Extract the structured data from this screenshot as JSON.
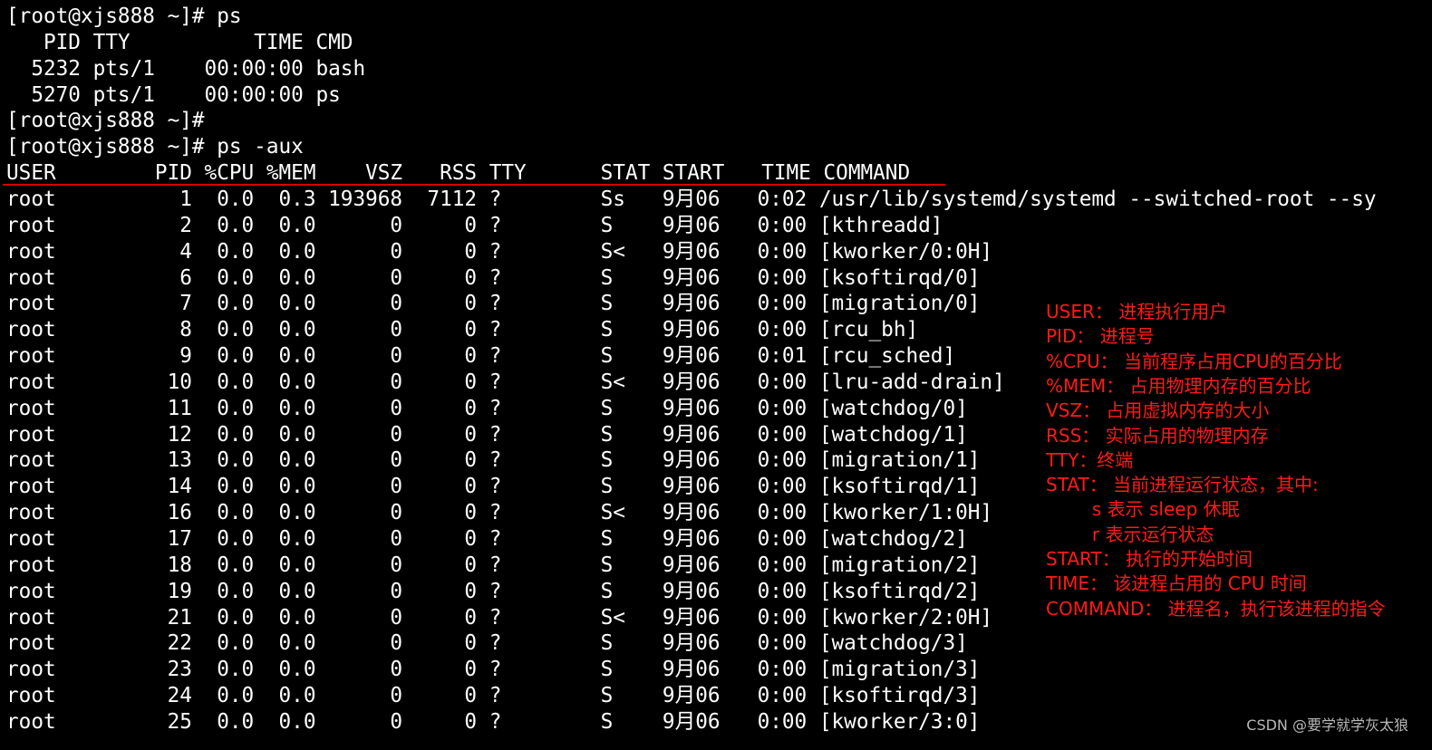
{
  "terminal": {
    "lines": [
      "[root@xjs888 ~]# ps",
      "   PID TTY          TIME CMD",
      "  5232 pts/1    00:00:00 bash",
      "  5270 pts/1    00:00:00 ps",
      "[root@xjs888 ~]#",
      "[root@xjs888 ~]# ps -aux",
      "USER        PID %CPU %MEM    VSZ   RSS TTY      STAT START   TIME COMMAND",
      "root          1  0.0  0.3 193968  7112 ?        Ss   9月06   0:02 /usr/lib/systemd/systemd --switched-root --sy",
      "root          2  0.0  0.0      0     0 ?        S    9月06   0:00 [kthreadd]",
      "root          4  0.0  0.0      0     0 ?        S<   9月06   0:00 [kworker/0:0H]",
      "root          6  0.0  0.0      0     0 ?        S    9月06   0:00 [ksoftirqd/0]",
      "root          7  0.0  0.0      0     0 ?        S    9月06   0:00 [migration/0]",
      "root          8  0.0  0.0      0     0 ?        S    9月06   0:00 [rcu_bh]",
      "root          9  0.0  0.0      0     0 ?        S    9月06   0:01 [rcu_sched]",
      "root         10  0.0  0.0      0     0 ?        S<   9月06   0:00 [lru-add-drain]",
      "root         11  0.0  0.0      0     0 ?        S    9月06   0:00 [watchdog/0]",
      "root         12  0.0  0.0      0     0 ?        S    9月06   0:00 [watchdog/1]",
      "root         13  0.0  0.0      0     0 ?        S    9月06   0:00 [migration/1]",
      "root         14  0.0  0.0      0     0 ?        S    9月06   0:00 [ksoftirqd/1]",
      "root         16  0.0  0.0      0     0 ?        S<   9月06   0:00 [kworker/1:0H]",
      "root         17  0.0  0.0      0     0 ?        S    9月06   0:00 [watchdog/2]",
      "root         18  0.0  0.0      0     0 ?        S    9月06   0:00 [migration/2]",
      "root         19  0.0  0.0      0     0 ?        S    9月06   0:00 [ksoftirqd/2]",
      "root         21  0.0  0.0      0     0 ?        S<   9月06   0:00 [kworker/2:0H]",
      "root         22  0.0  0.0      0     0 ?        S    9月06   0:00 [watchdog/3]",
      "root         23  0.0  0.0      0     0 ?        S    9月06   0:00 [migration/3]",
      "root         24  0.0  0.0      0     0 ?        S    9月06   0:00 [ksoftirqd/3]",
      "root         25  0.0  0.0      0     0 ?        S    9月06   0:00 [kworker/3:0]"
    ],
    "background_color": "#000000",
    "text_color": "#ffffff"
  },
  "annotations": {
    "color": "#ff1a1a",
    "items": [
      "USER： 进程执行用户",
      "PID： 进程号",
      "%CPU： 当前程序占用CPU的百分比",
      "%MEM： 占用物理内存的百分比",
      "VSZ： 占用虚拟内存的大小",
      "RSS： 实际占用的物理内存",
      "TTY：终端",
      "STAT： 当前进程运行状态，其中:",
      "        s 表示 sleep 休眠",
      "        r 表示运行状态",
      "START： 执行的开始时间",
      "TIME： 该进程占用的 CPU 时间",
      "COMMAND： 进程名，执行该进程的指令"
    ]
  },
  "watermark": "CSDN @要学就学灰太狼"
}
